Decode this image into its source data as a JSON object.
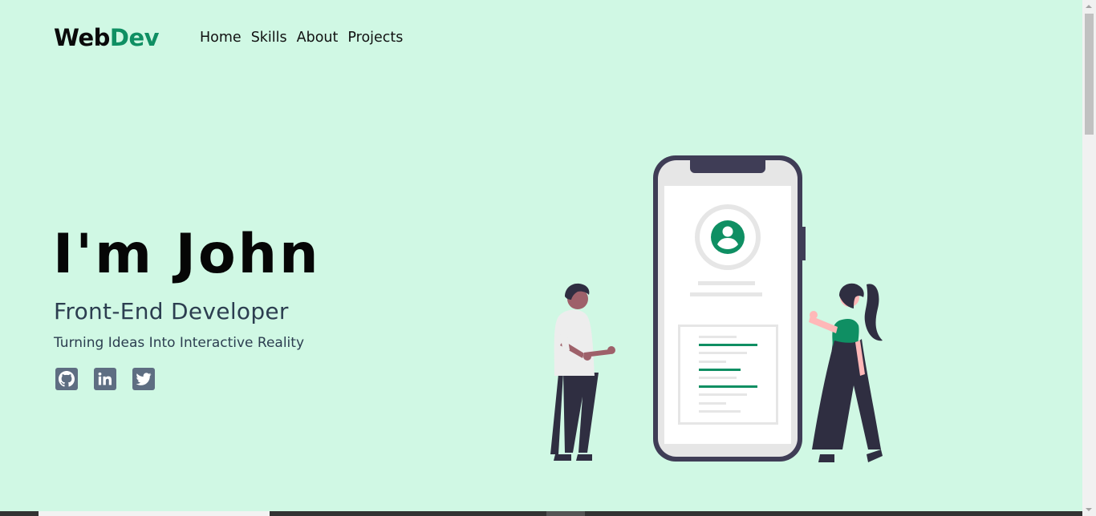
{
  "header": {
    "logo_main": "Web",
    "logo_accent": "Dev",
    "nav": [
      "Home",
      "Skills",
      "About",
      "Projects"
    ]
  },
  "hero": {
    "title": "I'm John",
    "role": "Front-End Developer",
    "tagline": "Turning Ideas Into Interactive Reality"
  },
  "socials": [
    {
      "icon": "github-icon"
    },
    {
      "icon": "linkedin-icon"
    },
    {
      "icon": "twitter-icon"
    }
  ],
  "colors": {
    "background": "#d0f8e4",
    "accent": "#0f8f63",
    "text_dark": "#060606",
    "text_muted": "#2c3e50",
    "icon_bg": "#5e6e82",
    "illustration_dark": "#2f2e41"
  }
}
